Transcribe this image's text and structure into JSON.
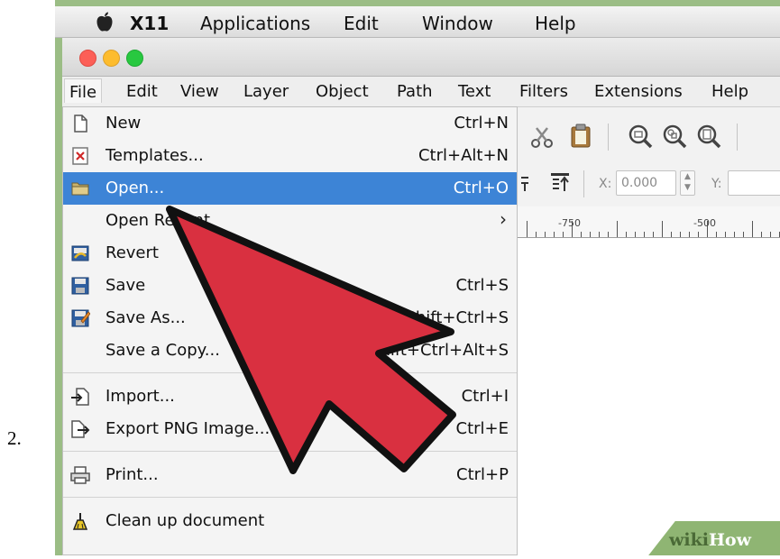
{
  "step_label": "2.",
  "mac_menubar": {
    "items": [
      {
        "label": "X11",
        "bold": true
      },
      {
        "label": "Applications"
      },
      {
        "label": "Edit"
      },
      {
        "label": "Window"
      },
      {
        "label": "Help"
      }
    ]
  },
  "app_menubar": {
    "items": [
      {
        "label": "File"
      },
      {
        "label": "Edit"
      },
      {
        "label": "View"
      },
      {
        "label": "Layer"
      },
      {
        "label": "Object"
      },
      {
        "label": "Path"
      },
      {
        "label": "Text"
      },
      {
        "label": "Filters"
      },
      {
        "label": "Extensions"
      },
      {
        "label": "Help"
      }
    ],
    "active_item": "File"
  },
  "toolbar": {
    "x_label": "X:",
    "x_value": "0.000",
    "y_label": "Y:",
    "ruler_labels": [
      "-750",
      "-500"
    ]
  },
  "file_menu": {
    "items": [
      {
        "label": "New",
        "shortcut": "Ctrl+N",
        "icon": "new-document-icon"
      },
      {
        "label": "Templates...",
        "shortcut": "Ctrl+Alt+N",
        "icon": "templates-icon"
      },
      {
        "label": "Open...",
        "shortcut": "Ctrl+O",
        "icon": "folder-icon",
        "highlighted": true
      },
      {
        "label": "Open Recent",
        "shortcut": "",
        "icon": "",
        "submenu": true
      },
      {
        "label": "Revert",
        "shortcut": "",
        "icon": "revert-icon"
      },
      {
        "label": "Save",
        "shortcut": "Ctrl+S",
        "icon": "save-icon"
      },
      {
        "label": "Save As...",
        "shortcut": "Shift+Ctrl+S",
        "icon": "save-as-icon"
      },
      {
        "label": "Save a Copy...",
        "shortcut": "Shift+Ctrl+Alt+S",
        "icon": ""
      },
      {
        "label": "Import...",
        "shortcut": "Ctrl+I",
        "icon": "import-icon"
      },
      {
        "label": "Export PNG Image...",
        "shortcut": "Ctrl+E",
        "icon": "export-icon"
      },
      {
        "label": "Print...",
        "shortcut": "Ctrl+P",
        "icon": "printer-icon"
      },
      {
        "label": "Clean up document",
        "shortcut": "",
        "icon": "clean-up-icon"
      }
    ]
  },
  "watermark": {
    "part1": "wiki",
    "part2": "How"
  },
  "colors": {
    "highlight": "#3d84d6",
    "arrow_fill": "#d93040",
    "frame_green": "#9bbd85",
    "close_button": "#fc5f57",
    "minimize_button": "#fdbc2e",
    "zoom_button": "#28c840"
  }
}
